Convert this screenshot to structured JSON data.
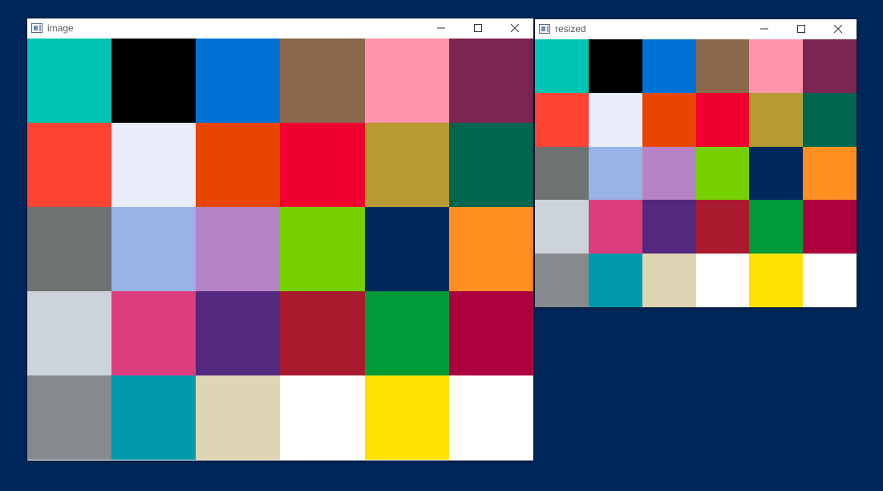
{
  "desktop": {
    "background": "#00285C"
  },
  "windows": [
    {
      "id": "image",
      "title": "image",
      "controls": [
        "minimize-icon",
        "maximize-icon",
        "close-icon"
      ]
    },
    {
      "id": "resized",
      "title": "resized",
      "controls": [
        "minimize-icon",
        "maximize-icon",
        "close-icon"
      ]
    }
  ],
  "grid": {
    "rows": 5,
    "cols": 6,
    "colors": [
      "#00C4B3",
      "#000000",
      "#0072D6",
      "#8A684C",
      "#FF94AB",
      "#7A2650",
      "#FF4433",
      "#E8EDF9",
      "#E84600",
      "#F0002F",
      "#B79A32",
      "#006650",
      "#6E7272",
      "#99B3E6",
      "#B683C6",
      "#76D000",
      "#00285C",
      "#FF8F21",
      "#CDD3DB",
      "#DD3C7E",
      "#52297E",
      "#AA1A2E",
      "#009A38",
      "#AE003E",
      "#848A8E",
      "#0099AE",
      "#DFD4B3",
      "#FFFFFF",
      "#FFE300",
      "#FFFFFF"
    ]
  }
}
